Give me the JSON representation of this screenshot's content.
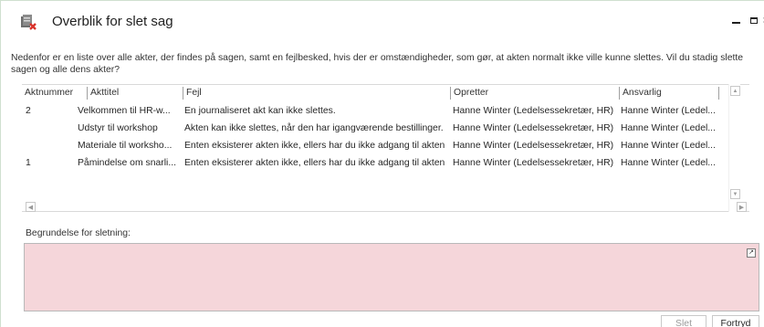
{
  "window": {
    "title": "Overblik for slet sag",
    "icon": "case-delete-icon",
    "controls": {
      "minimize": "minimize-icon",
      "maximize": "maximize-icon",
      "close_glyph": "×"
    }
  },
  "description": "Nedenfor er en liste over alle akter, der findes på sagen, samt en fejlbesked, hvis der er omstændigheder, som gør, at akten normalt ikke ville kunne slettes. Vil du stadig slette sagen og alle dens akter?",
  "grid": {
    "columns": [
      "Aktnummer",
      "Akttitel",
      "Fejl",
      "Opretter",
      "Ansvarlig"
    ],
    "rows": [
      {
        "aktnummer": "2",
        "akttitel": "Velkommen til HR-w...",
        "fejl": "En journaliseret akt kan ikke slettes.",
        "opretter": "Hanne Winter (Ledelsessekretær, HR)",
        "ansvarlig": "Hanne Winter (Ledel..."
      },
      {
        "aktnummer": "",
        "akttitel": "Udstyr til workshop",
        "fejl": "Akten kan ikke slettes, når den har igangværende bestillinger.",
        "opretter": "Hanne Winter (Ledelsessekretær, HR)",
        "ansvarlig": "Hanne Winter (Ledel..."
      },
      {
        "aktnummer": "",
        "akttitel": "Materiale til worksho...",
        "fejl": "Enten eksisterer akten ikke, ellers har du ikke adgang til akten",
        "opretter": "Hanne Winter (Ledelsessekretær, HR)",
        "ansvarlig": "Hanne Winter (Ledel..."
      },
      {
        "aktnummer": "1",
        "akttitel": "Påmindelse om snarli...",
        "fejl": "Enten eksisterer akten ikke, ellers har du ikke adgang til akten",
        "opretter": "Hanne Winter (Ledelsessekretær, HR)",
        "ansvarlig": "Hanne Winter (Ledel..."
      }
    ]
  },
  "reason": {
    "label": "Begrundelse for sletning:",
    "value": "",
    "background_color": "#f5d6da",
    "expand_icon": "expand-icon"
  },
  "buttons": {
    "delete": "Slet",
    "cancel": "Fortryd"
  }
}
